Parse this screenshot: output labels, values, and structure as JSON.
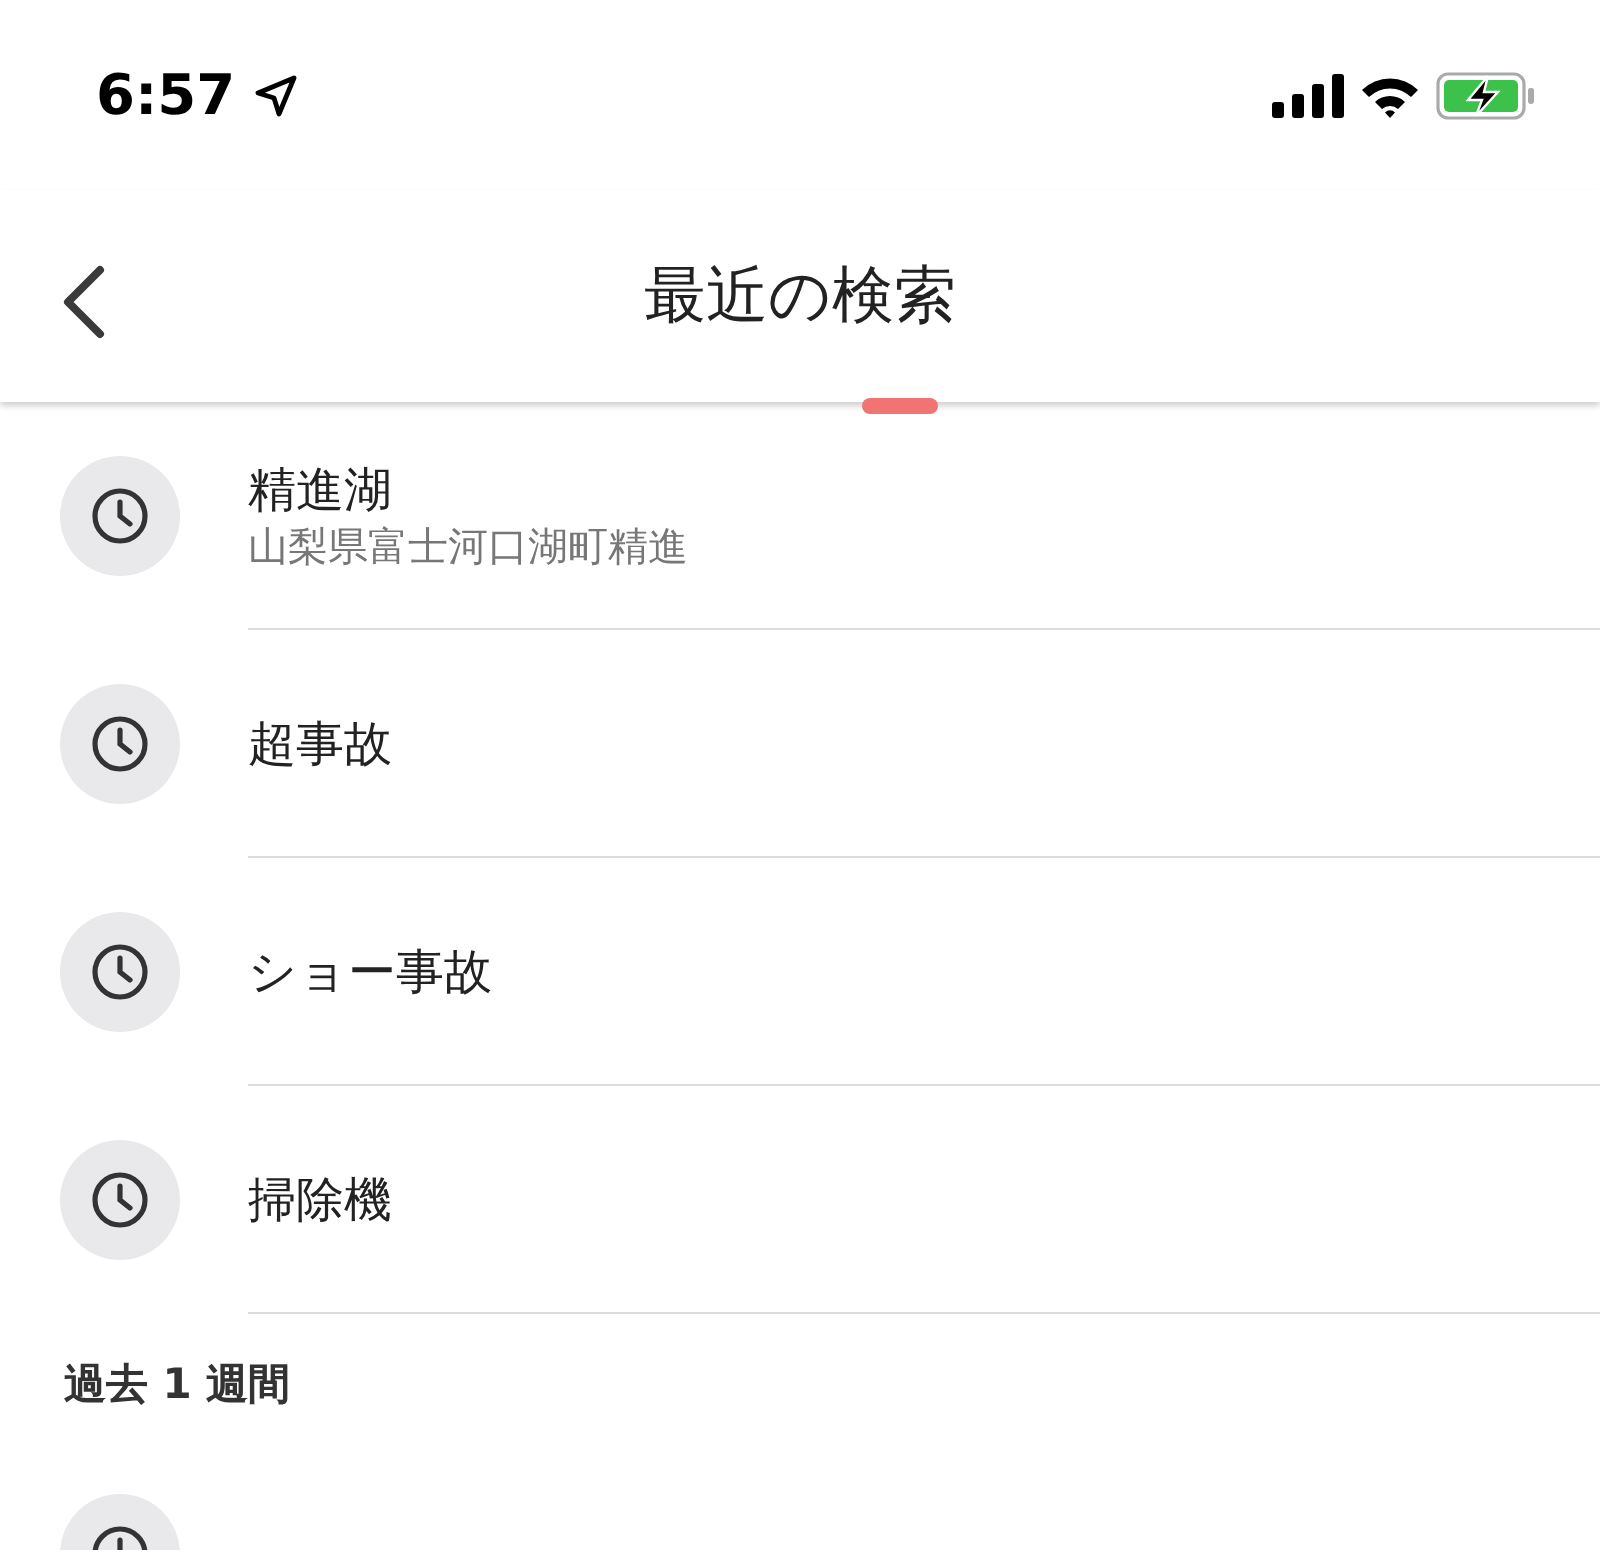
{
  "status_bar": {
    "time": "6:57"
  },
  "header": {
    "title": "最近の検索"
  },
  "recent": [
    {
      "title": "精進湖",
      "subtitle": "山梨県富士河口湖町精進"
    },
    {
      "title": "超事故"
    },
    {
      "title": "ショー事故"
    },
    {
      "title": "掃除機"
    }
  ],
  "sections": [
    {
      "heading": "過去 1 週間"
    }
  ]
}
